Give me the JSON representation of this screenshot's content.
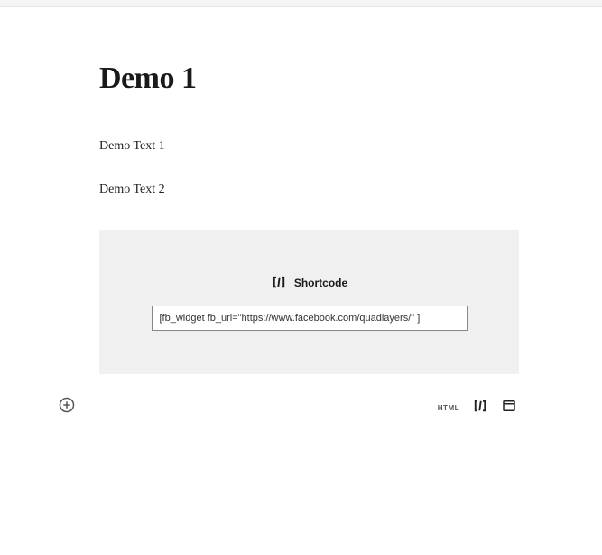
{
  "page": {
    "title": "Demo 1",
    "paragraphs": [
      "Demo Text 1",
      "Demo Text 2"
    ]
  },
  "shortcode_block": {
    "label": "Shortcode",
    "value": "[fb_widget fb_url=\"https://www.facebook.com/quadlayers/\" ]"
  },
  "toolbar": {
    "html_label": "HTML"
  },
  "icons": {
    "add": "add-icon",
    "shortcode": "shortcode-icon",
    "html": "html-icon",
    "shortcode_tool": "shortcode-tool-icon",
    "widget": "widget-icon"
  }
}
